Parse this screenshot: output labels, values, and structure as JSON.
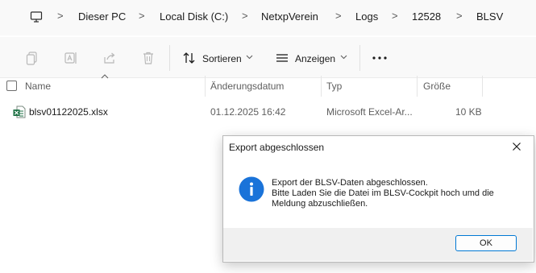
{
  "breadcrumb": {
    "items": [
      "Dieser PC",
      "Local Disk (C:)",
      "NetxpVerein",
      "Logs",
      "12528",
      "BLSV"
    ],
    "separator": ">"
  },
  "toolbar": {
    "sort_label": "Sortieren",
    "view_label": "Anzeigen",
    "icons": [
      "copy-icon",
      "rename-icon",
      "share-icon",
      "delete-icon",
      "sort-icon",
      "view-icon",
      "more-icon"
    ]
  },
  "columns": {
    "name": "Name",
    "date": "Änderungsdatum",
    "type": "Typ",
    "size": "Größe"
  },
  "files": [
    {
      "name": "blsv01122025.xlsx",
      "date": "01.12.2025 16:42",
      "type": "Microsoft Excel-Ar...",
      "size": "10 KB",
      "icon": "excel-file-icon"
    }
  ],
  "dialog": {
    "title": "Export abgeschlossen",
    "message_line1": "Export der BLSV-Daten abgeschlossen.",
    "message_line2": "Bitte Laden Sie die Datei im BLSV-Cockpit hoch umd die",
    "message_line3": "Meldung abzuschließen.",
    "ok_label": "OK",
    "icon": "info-icon"
  },
  "colors": {
    "accent": "#0078d4",
    "excel_green": "#1e7145"
  }
}
